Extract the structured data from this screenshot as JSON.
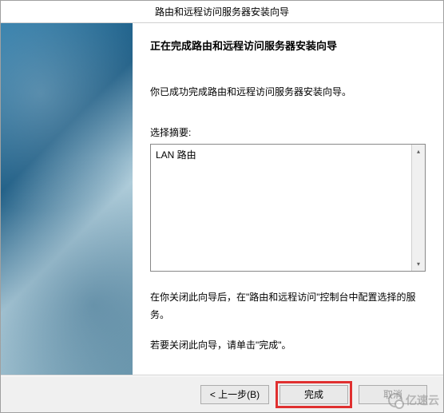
{
  "window": {
    "title": "路由和远程访问服务器安装向导"
  },
  "content": {
    "heading": "正在完成路由和远程访问服务器安装向导",
    "success_line": "你已成功完成路由和远程访问服务器安装向导。",
    "summary_label": "选择摘要:",
    "summary_text": "LAN 路由",
    "post_close_text": "在你关闭此向导后，在\"路由和远程访问\"控制台中配置选择的服务。",
    "finish_hint": "若要关闭此向导，请单击\"完成\"。"
  },
  "buttons": {
    "back": "< 上一步(B)",
    "finish": "完成",
    "cancel": "取消"
  },
  "watermark": {
    "text": "亿速云"
  }
}
